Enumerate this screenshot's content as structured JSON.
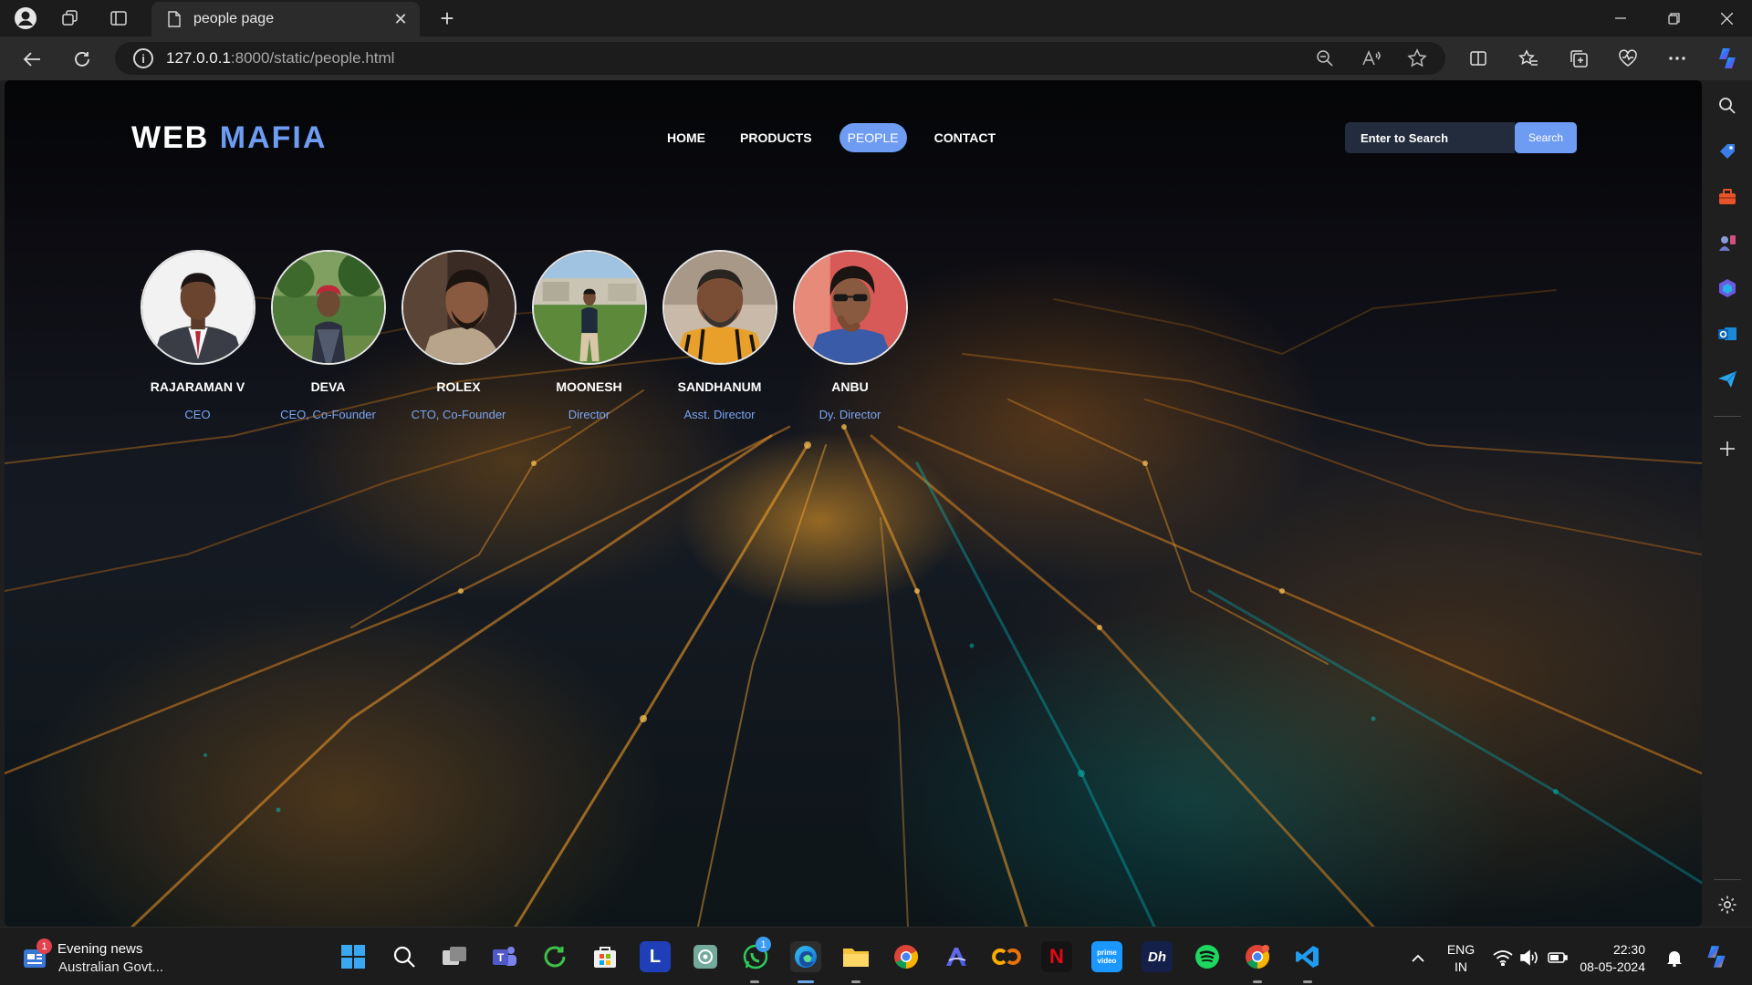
{
  "browser": {
    "tab_title": "people page",
    "url_host": "127.0.0.1",
    "url_path": ":8000/static/people.html"
  },
  "page": {
    "logo_main": "WEB",
    "logo_accent": "MAFIA",
    "nav": [
      {
        "label": "HOME",
        "active": false
      },
      {
        "label": "PRODUCTS",
        "active": false
      },
      {
        "label": "PEOPLE",
        "active": true
      },
      {
        "label": "CONTACT",
        "active": false
      }
    ],
    "search_placeholder": "Enter to Search",
    "search_button": "Search",
    "accent_color": "#6e9cf2",
    "people": [
      {
        "name": "RAJARAMAN V",
        "role": "CEO"
      },
      {
        "name": "DEVA",
        "role": "CEO, Co-Founder"
      },
      {
        "name": "ROLEX",
        "role": "CTO, Co-Founder"
      },
      {
        "name": "MOONESH",
        "role": "Director"
      },
      {
        "name": "SANDHANUM",
        "role": "Asst. Director"
      },
      {
        "name": "ANBU",
        "role": "Dy. Director"
      }
    ]
  },
  "taskbar": {
    "news_title": "Evening news",
    "news_subtitle": "Australian Govt...",
    "news_badge": "1",
    "whatsapp_badge": "1",
    "lang_line1": "ENG",
    "lang_line2": "IN",
    "time": "22:30",
    "date": "08-05-2024"
  }
}
